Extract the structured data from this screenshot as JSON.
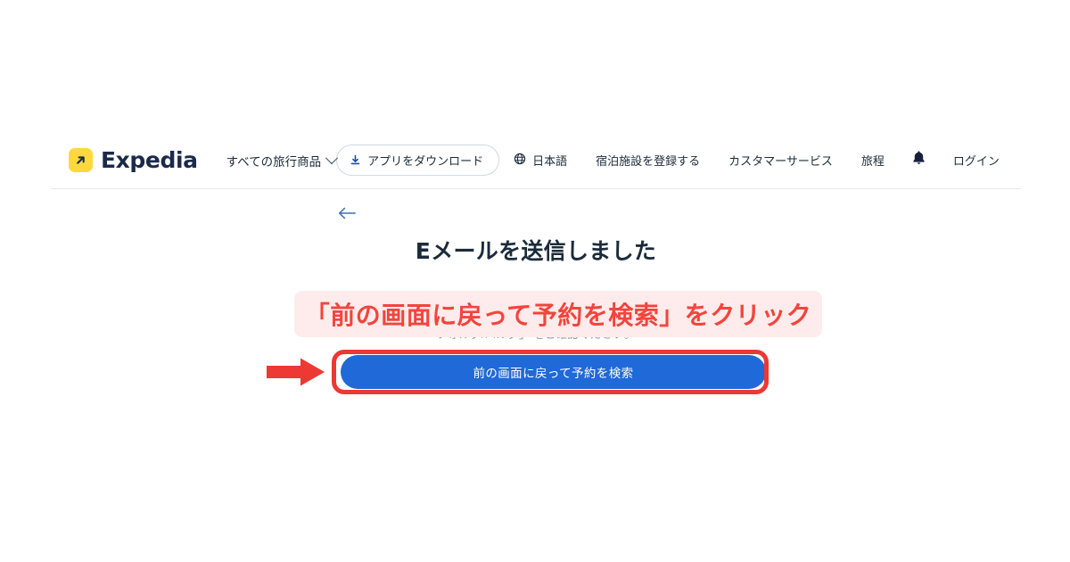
{
  "brand": {
    "name": "Expedia",
    "logo_icon": "arrow-up-right-icon",
    "logo_bg": "#ffd83d",
    "wordmark_color": "#1b2a4a"
  },
  "header": {
    "all_travel_label": "すべての旅行商品",
    "all_travel_chevron": "chevron-down-icon",
    "app_download": {
      "label": "アプリをダウンロード",
      "icon": "download-icon"
    },
    "language": {
      "label": "日本語",
      "icon": "globe-icon"
    },
    "links": [
      {
        "label": "宿泊施設を登録する"
      },
      {
        "label": "カスタマーサービス"
      },
      {
        "label": "旅程"
      }
    ],
    "notifications_icon": "bell-icon",
    "login_label": "ログイン"
  },
  "main": {
    "back_icon": "arrow-left-icon",
    "back_icon_color": "#3b6fb5",
    "title": "Eメールを送信しました",
    "body_text": "フォルダ/バルダ」 をご確認ください。",
    "cta_label": "前の画面に戻って予約を検索",
    "cta_color": "#1f69d8"
  },
  "annotation": {
    "banner_text": "「前の画面に戻って予約を検索」をクリック",
    "banner_text_color": "#f2453d",
    "banner_bg": "#fdeceb",
    "highlight_color": "#ed3833",
    "arrow_icon": "right-arrow-annotation-icon",
    "arrow_color": "#ed3833"
  }
}
